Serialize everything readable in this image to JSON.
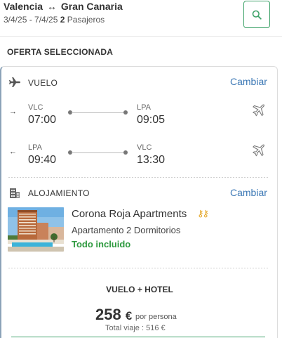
{
  "header": {
    "origin": "Valencia",
    "destination": "Gran Canaria",
    "dates": "3/4/25 - 7/4/25",
    "passenger_count": "2",
    "passenger_label": "Pasajeros",
    "search_icon": "search-icon"
  },
  "section_title": "OFERTA SELECCIONADA",
  "flight": {
    "label": "VUELO",
    "change_label": "Cambiar",
    "outbound": {
      "direction_icon": "arrow-right-icon",
      "from_code": "VLC",
      "from_time": "07:00",
      "to_code": "LPA",
      "to_time": "09:05",
      "airline_icon": "airline-plane-icon"
    },
    "return": {
      "direction_icon": "arrow-left-icon",
      "from_code": "LPA",
      "from_time": "09:40",
      "to_code": "VLC",
      "to_time": "13:30",
      "airline_icon": "airline-plane-icon"
    }
  },
  "accommodation": {
    "label": "ALOJAMIENTO",
    "change_label": "Cambiar",
    "hotel_name": "Corona Roja Apartments",
    "rating_keys": 2,
    "room_type": "Apartamento 2 Dormitorios",
    "board": "Todo incluido"
  },
  "package": {
    "title": "VUELO + HOTEL",
    "price": "258",
    "currency": "€",
    "price_unit": "por persona",
    "total_label": "Total viaje : 516 €"
  },
  "colors": {
    "accent_green": "#3fa36a",
    "link_blue": "#3c78b5",
    "board_green": "#2e9a3f",
    "key_gold": "#e2a11b"
  }
}
